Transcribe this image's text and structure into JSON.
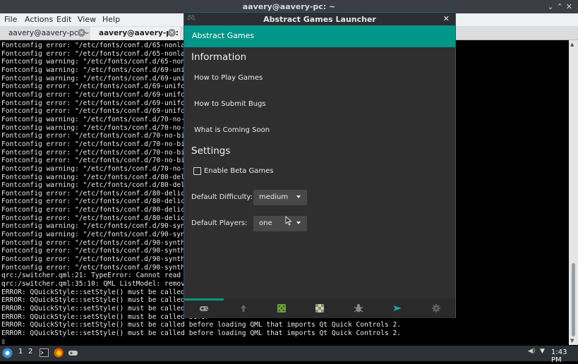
{
  "terminal": {
    "title": "aavery@aavery-pc: ~",
    "menu": [
      "File",
      "Actions",
      "Edit",
      "View",
      "Help"
    ],
    "tabs": [
      "aavery@aavery-pc: ~",
      "aavery@aavery-pc: ~"
    ],
    "lines": [
      "Fontconfig error: \"/etc/fonts/conf.d/65-nonlatin.co",
      "Fontconfig error: \"/etc/fonts/conf.d/65-nonlatin.co",
      "Fontconfig warning: \"/etc/fonts/conf.d/65-nonlatin.",
      "Fontconfig warning: \"/etc/fonts/conf.d/69-unifont.c",
      "Fontconfig warning: \"/etc/fonts/conf.d/69-unifont.c",
      "Fontconfig error: \"/etc/fonts/conf.d/69-unifont.co",
      "Fontconfig error: \"/etc/fonts/conf.d/69-unifont.co",
      "Fontconfig error: \"/etc/fonts/conf.d/69-unifont.co",
      "Fontconfig error: \"/etc/fonts/conf.d/69-unifont.co",
      "Fontconfig warning: \"/etc/fonts/conf.d/70-no-bitmap",
      "Fontconfig warning: \"/etc/fonts/conf.d/70-no-bitmap",
      "Fontconfig error: \"/etc/fonts/conf.d/70-no-bitmaps",
      "Fontconfig error: \"/etc/fonts/conf.d/70-no-bitmaps",
      "Fontconfig error: \"/etc/fonts/conf.d/70-no-bitmaps",
      "Fontconfig error: \"/etc/fonts/conf.d/70-no-bitmaps",
      "Fontconfig warning: \"/etc/fonts/conf.d/70-no-bitmap",
      "Fontconfig warning: \"/etc/fonts/conf.d/80-delicious",
      "Fontconfig warning: \"/etc/fonts/conf.d/80-delicious",
      "Fontconfig error: \"/etc/fonts/conf.d/80-delicious.",
      "Fontconfig error: \"/etc/fonts/conf.d/80-delicious.",
      "Fontconfig error: \"/etc/fonts/conf.d/80-delicious.",
      "Fontconfig error: \"/etc/fonts/conf.d/80-delicious.",
      "Fontconfig warning: \"/etc/fonts/conf.d/90-synthetic",
      "Fontconfig warning: \"/etc/fonts/conf.d/90-synthetic",
      "Fontconfig error: \"/etc/fonts/conf.d/90-synthetic.",
      "Fontconfig error: \"/etc/fonts/conf.d/90-synthetic.",
      "Fontconfig error: \"/etc/fonts/conf.d/90-synthetic.",
      "Fontconfig error: \"/etc/fonts/conf.d/90-synthetic.",
      "qrc:/switcher.qml:21: TypeError: Cannot read proper",
      "qrc:/switcher.qml:35:10: QML ListModel: remove: ind",
      "ERROR: QQuickStyle::setStyle() must be called befor",
      "ERROR: QQuickStyle::setStyle() must be called befor",
      "ERROR: QQuickStyle::setStyle() must be called befor",
      "ERROR: QQuickStyle::setStyle() must be called befor",
      "ERROR: QQuickStyle::setStyle() must be called before loading QML that imports Qt Quick Controls 2.",
      "ERROR: QQuickStyle::setStyle() must be called before loading QML that imports Qt Quick Controls 2.",
      "▯"
    ]
  },
  "app": {
    "title": "Abstract Games Launcher",
    "close_glyph": "✕",
    "header": "Abstract Games",
    "info_heading": "Information",
    "links": [
      "How to Play Games",
      "How to Submit Bugs",
      "What is Coming Soon"
    ],
    "settings_heading": "Settings",
    "beta_label": "Enable Beta Games",
    "beta_checked": false,
    "difficulty_label": "Default Difficulty:",
    "difficulty_value": "medium",
    "players_label": "Default Players:",
    "players_value": "one",
    "footer_icons": [
      "gamepad-icon",
      "up-arrow-icon",
      "dice-icon",
      "checkerboard-icon",
      "bug-icon",
      "send-icon",
      "gear-icon"
    ],
    "accent": "#009688"
  },
  "taskbar": {
    "workspaces": [
      "1",
      "2"
    ],
    "clock": "1:43 PM"
  }
}
